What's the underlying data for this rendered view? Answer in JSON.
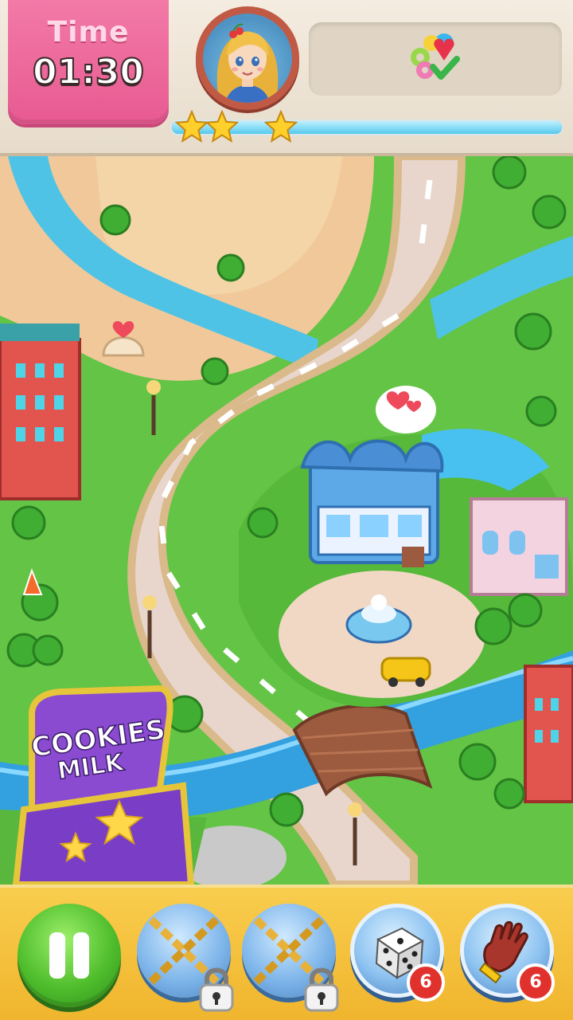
{
  "hud": {
    "timer_label": "Time",
    "timer_value": "01:30",
    "progress": 1.0,
    "stars_earned": 3
  },
  "map": {
    "sign_text_line1": "COOKIES",
    "sign_text_line2": "MILK"
  },
  "bottom_bar": {
    "boosters": [
      {
        "name": "chained-booster-1",
        "locked": true
      },
      {
        "name": "chained-booster-2",
        "locked": true
      },
      {
        "name": "dice-booster",
        "count": "6"
      },
      {
        "name": "glove-booster",
        "count": "6"
      }
    ]
  },
  "icons": {
    "pause": "pause-icon",
    "star": "star-icon",
    "dice": "dice-icon",
    "glove": "glove-icon",
    "lock": "lock-icon",
    "chain": "chain-icon",
    "goal_candy": "candy-goal-icon",
    "check": "check-icon"
  }
}
